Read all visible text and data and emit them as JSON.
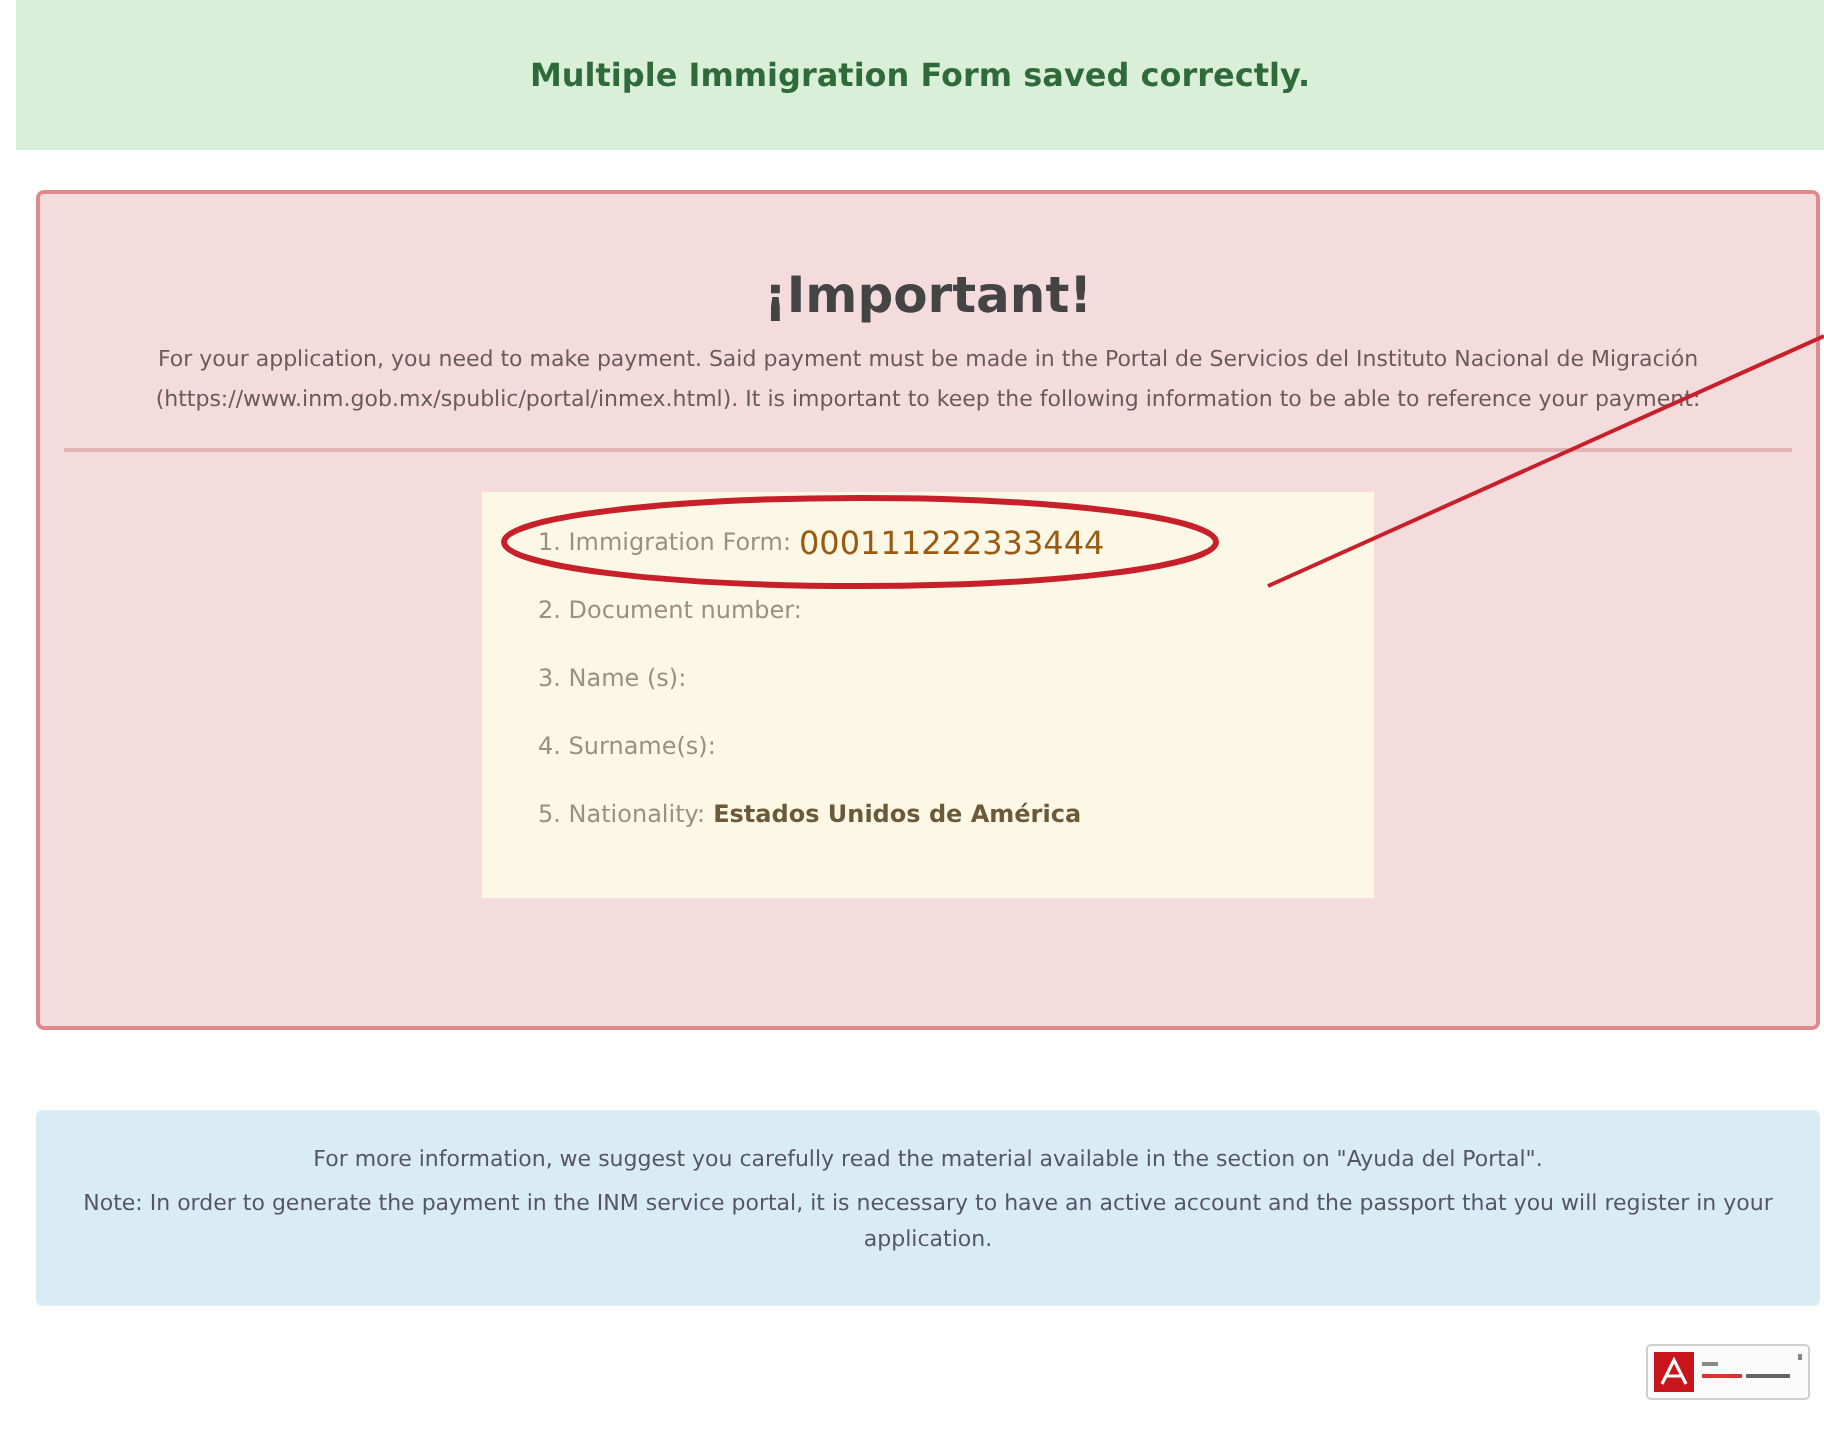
{
  "success_banner": {
    "message": "Multiple Immigration Form saved correctly."
  },
  "important_panel": {
    "title": "¡Important!",
    "text": "For your application, you need to make payment. Said payment must be made in the Portal de Servicios del Instituto Nacional de Migración (https://www.inm.gob.mx/spublic/portal/inmex.html). It is important to keep the following information to be able to reference your payment:",
    "items": [
      {
        "label": "1. Immigration Form:",
        "value": "000111222333444",
        "kind": "highlighted"
      },
      {
        "label": "2. Document number:",
        "kind": "empty"
      },
      {
        "label": "3. Name (s):",
        "kind": "empty"
      },
      {
        "label": "4. Surname(s):",
        "kind": "empty"
      },
      {
        "label": "5. Nationality:",
        "value": "Estados Unidos de América",
        "kind": "bold"
      }
    ]
  },
  "info_panel": {
    "lines": [
      "For more information, we suggest you carefully read the material available in the section on \"Ayuda del Portal\".",
      "Note: In order to generate the payment in the INM service portal, it is necessary to have an active account and the passport that you will register in your application."
    ]
  }
}
